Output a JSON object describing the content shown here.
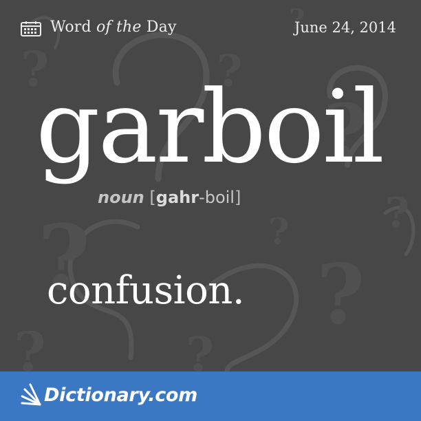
{
  "header": {
    "icon": "calendar-icon",
    "title_part1": "Word ",
    "title_italic": "of the",
    "title_part2": " Day",
    "date": "June 24, 2014"
  },
  "entry": {
    "word": "garboil",
    "part_of_speech": "noun",
    "pron_open": "[",
    "pron_stressed": "gahr",
    "pron_rest": "-boil",
    "pron_close": "]",
    "definition": "confusion."
  },
  "footer": {
    "logo_icon": "dictionary-rays-icon",
    "brand": "Dictionary.com"
  },
  "colors": {
    "background": "#474747",
    "footer": "#3a78c3",
    "text": "#ffffff"
  }
}
